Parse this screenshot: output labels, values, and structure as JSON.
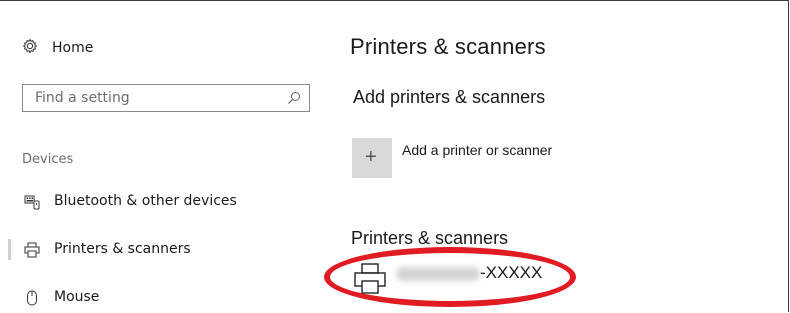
{
  "sidebar": {
    "home_label": "Home",
    "search_placeholder": "Find a setting",
    "section_title": "Devices",
    "items": [
      {
        "label": "Bluetooth & other devices",
        "icon": "keyboard-icon"
      },
      {
        "label": "Printers & scanners",
        "icon": "printer-icon",
        "selected": true
      },
      {
        "label": "Mouse",
        "icon": "mouse-icon"
      }
    ]
  },
  "main": {
    "page_title": "Printers & scanners",
    "add_section_title": "Add printers & scanners",
    "add_button_label": "Add a printer or scanner",
    "add_button_icon": "plus-icon",
    "list_section_title": "Printers & scanners",
    "printer": {
      "name_suffix": "-XXXXX",
      "icon": "printer-icon"
    }
  },
  "annotation": {
    "color": "#e11b22",
    "shape": "ellipse"
  }
}
